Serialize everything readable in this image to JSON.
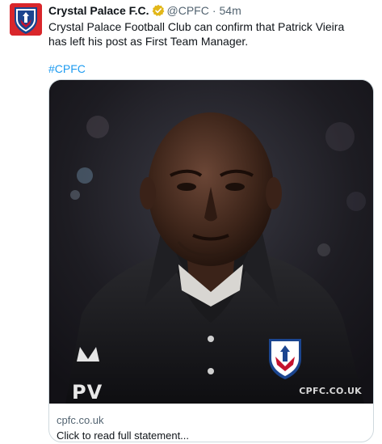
{
  "tweet": {
    "display_name": "Crystal Palace F.C.",
    "handle": "@CPFC",
    "separator": "·",
    "time": "54m",
    "text": "Crystal Palace Football Club can confirm that Patrick Vieira has left his post as First Team Manager.",
    "hashtag": "#CPFC"
  },
  "card": {
    "domain": "cpfc.co.uk",
    "title": "Click to read full statement...",
    "watermark": "CPFC.CO.UK",
    "jacket_initials": "PV"
  },
  "icons": {
    "avatar": "crystal-palace-crest-icon",
    "verified": "gold-verified-badge-icon"
  },
  "colors": {
    "link": "#1d9bf0",
    "secondary_text": "#536471",
    "verified_badge": "#e2b719",
    "avatar_bg": "#d9262b"
  }
}
